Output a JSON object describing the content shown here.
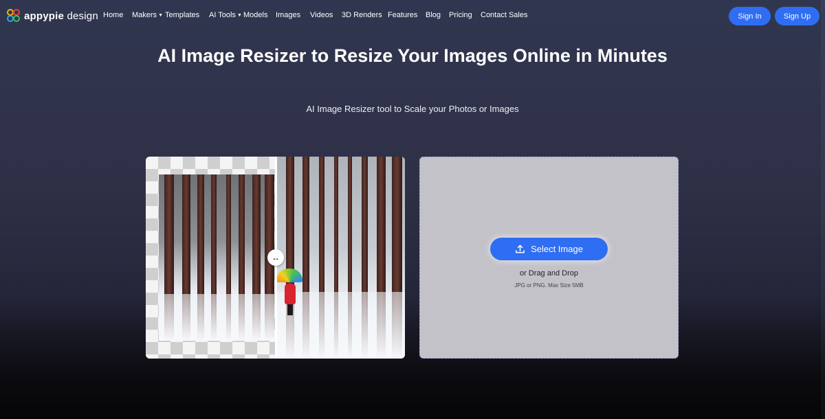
{
  "brand": {
    "bold": "appypie",
    "light": " design"
  },
  "nav": [
    {
      "label": "Home",
      "dropdown": false
    },
    {
      "label": "Makers",
      "dropdown": true
    },
    {
      "label": "Templates",
      "dropdown": false
    },
    {
      "label": "AI Tools",
      "dropdown": true
    },
    {
      "label": "Models",
      "dropdown": false
    },
    {
      "label": "Images",
      "dropdown": false
    },
    {
      "label": "Videos",
      "dropdown": false
    },
    {
      "label": "3D Renders",
      "dropdown": false
    },
    {
      "label": "Features",
      "dropdown": false
    },
    {
      "label": "Blog",
      "dropdown": false
    },
    {
      "label": "Pricing",
      "dropdown": false
    },
    {
      "label": "Contact Sales",
      "dropdown": false
    }
  ],
  "auth": {
    "sign_in": "Sign In",
    "sign_up": "Sign Up"
  },
  "hero": {
    "title": "AI Image Resizer to Resize Your Images Online in Minutes",
    "subtitle": "AI Image Resizer tool to Scale your Photos or Images"
  },
  "upload": {
    "button": "Select Image",
    "drag": "or Drag and Drop",
    "hint": "JPG or PNG. Max Size 5MB"
  },
  "colors": {
    "accent": "#2f6ef3",
    "upload_bg": "#c4c2c9"
  },
  "icons": {
    "upload": "upload-icon",
    "handle": "resize-handle-icon"
  }
}
